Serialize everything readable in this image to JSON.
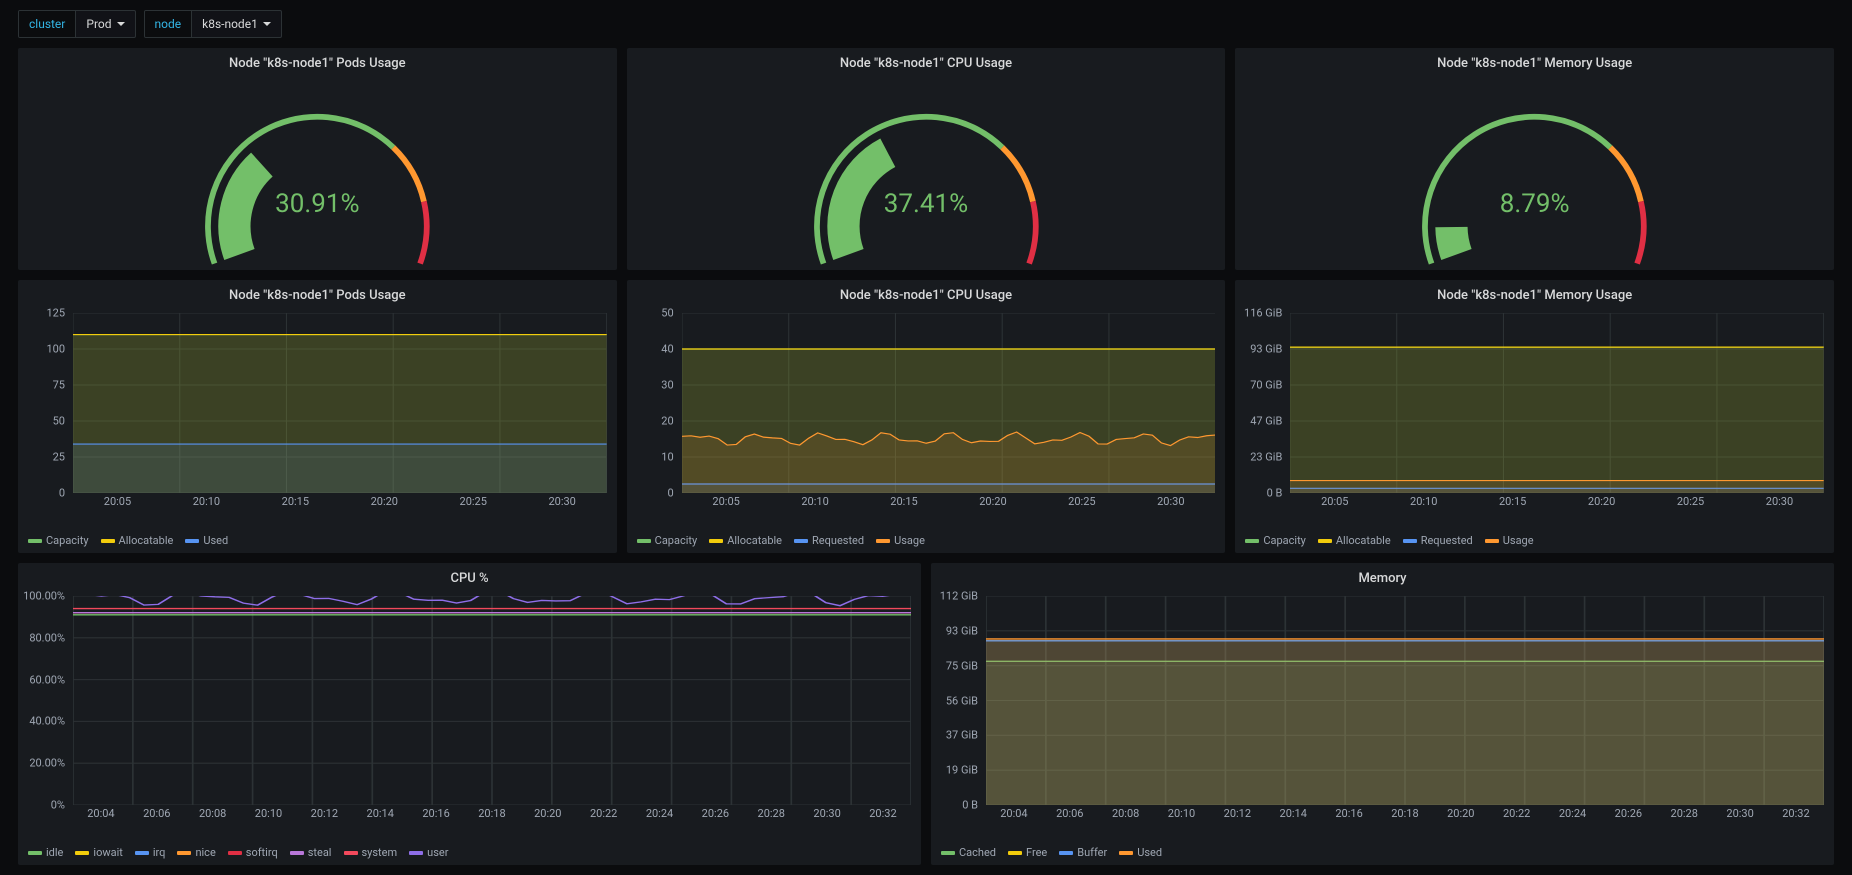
{
  "vars": {
    "cluster_label": "cluster",
    "cluster_value": "Prod",
    "node_label": "node",
    "node_value": "k8s-node1"
  },
  "gauges": [
    {
      "title": "Node \"k8s-node1\" Pods Usage",
      "value": 30.91,
      "display": "30.91%",
      "thresholds": [
        70,
        85
      ]
    },
    {
      "title": "Node \"k8s-node1\" CPU Usage",
      "value": 37.41,
      "display": "37.41%",
      "thresholds": [
        70,
        85
      ]
    },
    {
      "title": "Node \"k8s-node1\" Memory Usage",
      "value": 8.79,
      "display": "8.79%",
      "thresholds": [
        70,
        85
      ]
    }
  ],
  "timeseries": [
    {
      "title": "Node \"k8s-node1\" Pods Usage",
      "ymax": 125,
      "y_ticks": [
        "0",
        "25",
        "50",
        "75",
        "100",
        "125"
      ],
      "x_ticks": [
        "20:05",
        "20:10",
        "20:15",
        "20:20",
        "20:25",
        "20:30"
      ],
      "series": [
        {
          "name": "Capacity",
          "color": "#73bf69",
          "value": 110,
          "fill": true
        },
        {
          "name": "Allocatable",
          "color": "#f2cc0c",
          "value": 110,
          "fill": true
        },
        {
          "name": "Used",
          "color": "#5794f2",
          "value": 34,
          "fill": true
        }
      ]
    },
    {
      "title": "Node \"k8s-node1\" CPU Usage",
      "ymax": 50,
      "y_ticks": [
        "0",
        "10",
        "20",
        "30",
        "40",
        "50"
      ],
      "x_ticks": [
        "20:05",
        "20:10",
        "20:15",
        "20:20",
        "20:25",
        "20:30"
      ],
      "series": [
        {
          "name": "Capacity",
          "color": "#73bf69",
          "value": 40,
          "fill": true
        },
        {
          "name": "Allocatable",
          "color": "#f2cc0c",
          "value": 40,
          "fill": true
        },
        {
          "name": "Requested",
          "color": "#5794f2",
          "value": 2.5,
          "fill": true
        },
        {
          "name": "Usage",
          "color": "#ff9830",
          "value": 15,
          "fill": true,
          "noisy": true
        }
      ]
    },
    {
      "title": "Node \"k8s-node1\" Memory Usage",
      "ymax": 116,
      "y_unit": "GiB",
      "y_ticks": [
        "0 B",
        "23 GiB",
        "47 GiB",
        "70 GiB",
        "93 GiB",
        "116 GiB"
      ],
      "x_ticks": [
        "20:05",
        "20:10",
        "20:15",
        "20:20",
        "20:25",
        "20:30"
      ],
      "series": [
        {
          "name": "Capacity",
          "color": "#73bf69",
          "value": 94,
          "fill": true
        },
        {
          "name": "Allocatable",
          "color": "#f2cc0c",
          "value": 94,
          "fill": true
        },
        {
          "name": "Requested",
          "color": "#5794f2",
          "value": 3,
          "fill": true
        },
        {
          "name": "Usage",
          "color": "#ff9830",
          "value": 8,
          "fill": true
        }
      ]
    }
  ],
  "wide": [
    {
      "title": "CPU %",
      "ymax": 100,
      "y_ticks": [
        "0%",
        "20.00%",
        "40.00%",
        "60.00%",
        "80.00%",
        "100.00%"
      ],
      "x_ticks": [
        "20:04",
        "20:06",
        "20:08",
        "20:10",
        "20:12",
        "20:14",
        "20:16",
        "20:18",
        "20:20",
        "20:22",
        "20:24",
        "20:26",
        "20:28",
        "20:30",
        "20:32"
      ],
      "series": [
        {
          "name": "idle",
          "color": "#73bf69",
          "value": 91
        },
        {
          "name": "iowait",
          "color": "#f2cc0c",
          "value": 92
        },
        {
          "name": "irq",
          "color": "#5794f2",
          "value": 92
        },
        {
          "name": "nice",
          "color": "#ff9830",
          "value": 92
        },
        {
          "name": "softirq",
          "color": "#e02f44",
          "value": 92
        },
        {
          "name": "steal",
          "color": "#b877d9",
          "value": 92
        },
        {
          "name": "system",
          "color": "#f2495c",
          "value": 94
        },
        {
          "name": "user",
          "color": "#8e6ee8",
          "value": 99,
          "noisy": true
        }
      ]
    },
    {
      "title": "Memory",
      "ymax": 112,
      "y_unit": "GiB",
      "y_ticks": [
        "0 B",
        "19 GiB",
        "37 GiB",
        "56 GiB",
        "75 GiB",
        "93 GiB",
        "112 GiB"
      ],
      "x_ticks": [
        "20:04",
        "20:06",
        "20:08",
        "20:10",
        "20:12",
        "20:14",
        "20:16",
        "20:18",
        "20:20",
        "20:22",
        "20:24",
        "20:26",
        "20:28",
        "20:30",
        "20:32"
      ],
      "series": [
        {
          "name": "Cached",
          "color": "#73bf69",
          "value": 77,
          "fill": true
        },
        {
          "name": "Free",
          "color": "#f2cc0c",
          "value": 88,
          "fill": true
        },
        {
          "name": "Buffer",
          "color": "#5794f2",
          "value": 88,
          "fill": true
        },
        {
          "name": "Used",
          "color": "#ff9830",
          "value": 89,
          "fill": true
        }
      ]
    }
  ],
  "chart_data": [
    {
      "type": "gauge",
      "title": "Node \"k8s-node1\" Pods Usage",
      "value_pct": 30.91,
      "thresholds_pct": [
        70,
        85
      ]
    },
    {
      "type": "gauge",
      "title": "Node \"k8s-node1\" CPU Usage",
      "value_pct": 37.41,
      "thresholds_pct": [
        70,
        85
      ]
    },
    {
      "type": "gauge",
      "title": "Node \"k8s-node1\" Memory Usage",
      "value_pct": 8.79,
      "thresholds_pct": [
        70,
        85
      ]
    },
    {
      "type": "line",
      "title": "Node \"k8s-node1\" Pods Usage",
      "xlabel": "",
      "ylabel": "",
      "ylim": [
        0,
        125
      ],
      "x": [
        "20:05",
        "20:10",
        "20:15",
        "20:20",
        "20:25",
        "20:30"
      ],
      "series": [
        {
          "name": "Capacity",
          "values": [
            110,
            110,
            110,
            110,
            110,
            110
          ]
        },
        {
          "name": "Allocatable",
          "values": [
            110,
            110,
            110,
            110,
            110,
            110
          ]
        },
        {
          "name": "Used",
          "values": [
            34,
            34,
            34,
            34,
            34,
            34
          ]
        }
      ]
    },
    {
      "type": "line",
      "title": "Node \"k8s-node1\" CPU Usage",
      "xlabel": "",
      "ylabel": "",
      "ylim": [
        0,
        50
      ],
      "x": [
        "20:05",
        "20:10",
        "20:15",
        "20:20",
        "20:25",
        "20:30"
      ],
      "series": [
        {
          "name": "Capacity",
          "values": [
            40,
            40,
            40,
            40,
            40,
            40
          ]
        },
        {
          "name": "Allocatable",
          "values": [
            40,
            40,
            40,
            40,
            40,
            40
          ]
        },
        {
          "name": "Requested",
          "values": [
            2.5,
            2.5,
            2.5,
            2.5,
            2.5,
            2.5
          ]
        },
        {
          "name": "Usage",
          "values": [
            16,
            15,
            14,
            15,
            16,
            15
          ]
        }
      ]
    },
    {
      "type": "line",
      "title": "Node \"k8s-node1\" Memory Usage",
      "xlabel": "",
      "ylabel": "GiB",
      "ylim": [
        0,
        116
      ],
      "x": [
        "20:05",
        "20:10",
        "20:15",
        "20:20",
        "20:25",
        "20:30"
      ],
      "series": [
        {
          "name": "Capacity",
          "values": [
            94,
            94,
            94,
            94,
            94,
            94
          ]
        },
        {
          "name": "Allocatable",
          "values": [
            94,
            94,
            94,
            94,
            94,
            94
          ]
        },
        {
          "name": "Requested",
          "values": [
            3,
            3,
            3,
            3,
            3,
            3
          ]
        },
        {
          "name": "Usage",
          "values": [
            8,
            8,
            8,
            8,
            8,
            8
          ]
        }
      ]
    },
    {
      "type": "line",
      "title": "CPU %",
      "xlabel": "",
      "ylabel": "%",
      "ylim": [
        0,
        100
      ],
      "x": [
        "20:04",
        "20:06",
        "20:08",
        "20:10",
        "20:12",
        "20:14",
        "20:16",
        "20:18",
        "20:20",
        "20:22",
        "20:24",
        "20:26",
        "20:28",
        "20:30",
        "20:32"
      ],
      "series": [
        {
          "name": "idle",
          "values": [
            91,
            91,
            91,
            91,
            91,
            91,
            91,
            91,
            91,
            91,
            91,
            91,
            91,
            91,
            91
          ]
        },
        {
          "name": "iowait",
          "values": [
            92,
            92,
            92,
            92,
            92,
            92,
            92,
            92,
            92,
            92,
            92,
            92,
            92,
            92,
            92
          ]
        },
        {
          "name": "irq",
          "values": [
            92,
            92,
            92,
            92,
            92,
            92,
            92,
            92,
            92,
            92,
            92,
            92,
            92,
            92,
            92
          ]
        },
        {
          "name": "nice",
          "values": [
            92,
            92,
            92,
            92,
            92,
            92,
            92,
            92,
            92,
            92,
            92,
            92,
            92,
            92,
            92
          ]
        },
        {
          "name": "softirq",
          "values": [
            92,
            92,
            92,
            92,
            92,
            92,
            92,
            92,
            92,
            92,
            92,
            92,
            92,
            92,
            92
          ]
        },
        {
          "name": "steal",
          "values": [
            92,
            92,
            92,
            92,
            92,
            92,
            92,
            92,
            92,
            92,
            92,
            92,
            92,
            92,
            92
          ]
        },
        {
          "name": "system",
          "values": [
            94,
            94,
            94,
            94,
            94,
            94,
            94,
            94,
            94,
            94,
            94,
            94,
            94,
            94,
            94
          ]
        },
        {
          "name": "user",
          "values": [
            99,
            98,
            100,
            99,
            98,
            100,
            99,
            98,
            99,
            100,
            99,
            99,
            98,
            99,
            99
          ]
        }
      ]
    },
    {
      "type": "line",
      "title": "Memory",
      "xlabel": "",
      "ylabel": "GiB",
      "ylim": [
        0,
        112
      ],
      "x": [
        "20:04",
        "20:06",
        "20:08",
        "20:10",
        "20:12",
        "20:14",
        "20:16",
        "20:18",
        "20:20",
        "20:22",
        "20:24",
        "20:26",
        "20:28",
        "20:30",
        "20:32"
      ],
      "series": [
        {
          "name": "Cached",
          "values": [
            77,
            77,
            77,
            77,
            77,
            77,
            77,
            77,
            77,
            77,
            77,
            77,
            77,
            77,
            77
          ]
        },
        {
          "name": "Free",
          "values": [
            88,
            88,
            88,
            88,
            88,
            88,
            88,
            88,
            88,
            88,
            88,
            88,
            88,
            88,
            88
          ]
        },
        {
          "name": "Buffer",
          "values": [
            88,
            88,
            88,
            88,
            88,
            88,
            88,
            88,
            88,
            88,
            88,
            88,
            88,
            88,
            88
          ]
        },
        {
          "name": "Used",
          "values": [
            89,
            89,
            89,
            89,
            89,
            89,
            89,
            89,
            89,
            89,
            89,
            89,
            89,
            89,
            89
          ]
        }
      ]
    }
  ]
}
